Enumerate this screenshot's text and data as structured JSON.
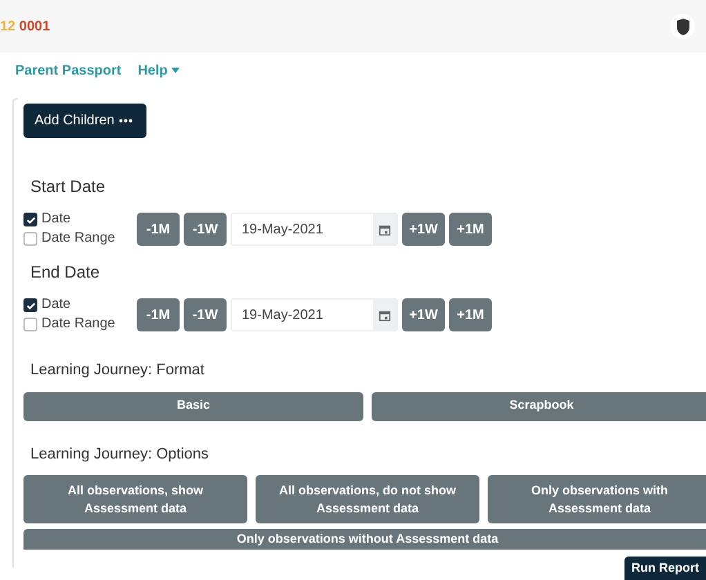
{
  "header": {
    "code_prefix": "12",
    "code": "0001"
  },
  "nav": [
    {
      "label": "Parent Passport",
      "dropdown": false
    },
    {
      "label": "Help",
      "dropdown": true
    }
  ],
  "add_children": {
    "label": "Add Children"
  },
  "date_sections": [
    {
      "title": "Start Date",
      "modes": [
        {
          "label": "Date",
          "checked": true
        },
        {
          "label": "Date Range",
          "checked": false
        }
      ],
      "back_buttons": [
        "-1M",
        "-1W"
      ],
      "value": "19-May-2021",
      "forward_buttons": [
        "+1W",
        "+1M"
      ]
    },
    {
      "title": "End Date",
      "modes": [
        {
          "label": "Date",
          "checked": true
        },
        {
          "label": "Date Range",
          "checked": false
        }
      ],
      "back_buttons": [
        "-1M",
        "-1W"
      ],
      "value": "19-May-2021",
      "forward_buttons": [
        "+1W",
        "+1M"
      ]
    }
  ],
  "format": {
    "title": "Learning Journey: Format",
    "options": [
      "Basic",
      "Scrapbook"
    ]
  },
  "options": {
    "title": "Learning Journey: Options",
    "items": [
      [
        "All observations, show",
        "Assessment data"
      ],
      [
        "All observations, do not show",
        "Assessment data"
      ],
      [
        "Only observations with",
        "Assessment data"
      ],
      [
        "Only observations without Assessment data"
      ]
    ]
  },
  "run_button": {
    "label": "Run Report"
  }
}
